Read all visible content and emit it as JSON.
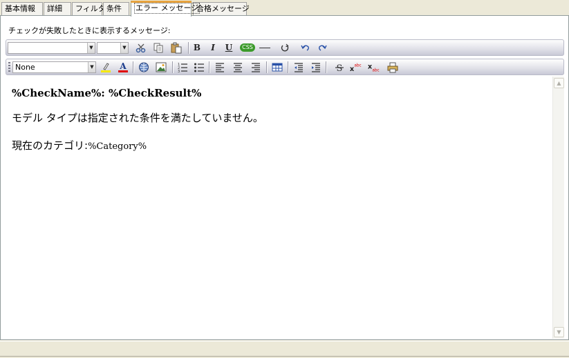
{
  "tabs": [
    {
      "label": "基本情報",
      "active": false
    },
    {
      "label": "詳細",
      "active": false
    },
    {
      "label": "フィルタ",
      "active": false
    },
    {
      "label": "条件",
      "active": false
    },
    {
      "label": "エラー メッセージ",
      "active": true
    },
    {
      "label": "合格メッセージ",
      "active": false
    }
  ],
  "prompt": "チェックが失敗したときに表示するメッセージ:",
  "toolbar1": {
    "font_combo_value": "",
    "size_combo_value": "",
    "bold": "B",
    "italic": "I",
    "underline": "U",
    "css_label": "CSS"
  },
  "toolbar2": {
    "style_combo_value": "None"
  },
  "editor": {
    "line1": "%CheckName%: %CheckResult%",
    "line2": "モデル タイプは指定された条件を満たしていません。",
    "line3_prefix": "現在のカテゴリ:",
    "line3_var": "%Category%"
  },
  "icons": {
    "cut": "cut-icon",
    "copy": "copy-icon",
    "paste": "paste-icon",
    "hr": "horizontal-rule-icon",
    "refresh": "refresh-icon",
    "undo": "undo-icon",
    "redo": "redo-icon",
    "highlight": "highlight-color-icon",
    "font_color": "font-color-icon",
    "link": "hyperlink-icon",
    "image": "image-icon",
    "ordered_list": "ordered-list-icon",
    "unordered_list": "unordered-list-icon",
    "align_left": "align-left-icon",
    "align_center": "align-center-icon",
    "align_right": "align-right-icon",
    "table": "table-icon",
    "outdent": "outdent-icon",
    "indent": "indent-icon",
    "strike": "strikethrough-icon",
    "superscript": "superscript-icon",
    "subscript": "subscript-icon",
    "print": "print-icon"
  },
  "colors": {
    "active_tab_accent": "#e8a33d",
    "css_badge": "#3b9a2a",
    "highlight_bar": "#f5e800",
    "font_color_bar": "#e00000"
  }
}
